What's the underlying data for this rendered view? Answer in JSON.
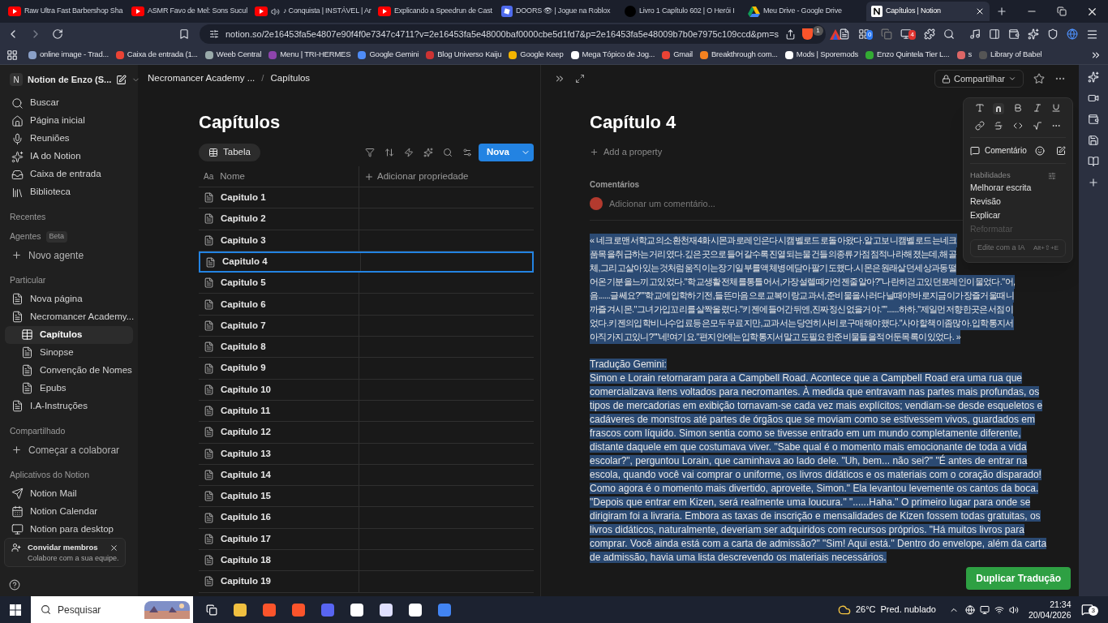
{
  "browser": {
    "tabs": [
      {
        "kind": "youtube",
        "title": "Raw Ultra Fast Barbershop Sha",
        "audio": false,
        "selected": false
      },
      {
        "kind": "youtube",
        "title": "ASMR Favo de Mel: Sons Sucul",
        "audio": false,
        "selected": false
      },
      {
        "kind": "youtube",
        "title": "♪ Conquista | INSTÁVEL | Ar",
        "audio": true,
        "selected": false
      },
      {
        "kind": "youtube",
        "title": "Explicando a Speedrun de Cast",
        "audio": false,
        "selected": false
      },
      {
        "kind": "roblox",
        "title": "DOORS 👁 | Jogue na Roblox",
        "audio": false,
        "selected": false
      },
      {
        "kind": "novel",
        "title": "Livro 1 Capítulo 602 | O Herói I",
        "audio": false,
        "selected": false
      },
      {
        "kind": "drive",
        "title": "Meu Drive - Google Drive",
        "audio": false,
        "selected": false
      },
      {
        "kind": "notion",
        "title": "Capítulos | Notion",
        "audio": false,
        "selected": true
      }
    ],
    "url": "notion.so/2e16453fa5e4807e90f4f0e7347c4711?v=2e16453fa5e48000baf0000cbe5d1fd7&p=2e16453fa5e48009b7b0e7975c109ccd&pm=s",
    "shield_count": "1",
    "extension_badges": [
      "0",
      "4"
    ],
    "bookmarks": [
      "online image - Trad...",
      "Caixa de entrada (1...",
      "Weeb Central",
      "Menu | TRI-HERMES",
      "Google Gemini",
      "Blog Universo Kaiju",
      "Google Keep",
      "Mega Tópico de Jog...",
      "Gmail",
      "Breakthrough com...",
      "Mods | Sporemods",
      "Enzo Quintela Tier L...",
      "s",
      "Library of Babel"
    ]
  },
  "sidebar": {
    "workspace_initial": "N",
    "workspace": "Notion de Enzo (S...",
    "nav": [
      "Buscar",
      "Página inicial",
      "Reuniões",
      "IA do Notion",
      "Caixa de entrada",
      "Biblioteca"
    ],
    "recent_heading": "Recentes",
    "agents_heading": "Agentes",
    "agents_badge": "Beta",
    "new_agent": "Novo agente",
    "private_heading": "Particular",
    "pages": [
      {
        "kind": "page",
        "label": "Nova página",
        "selected": false
      },
      {
        "kind": "page",
        "label": "Necromancer Academy...",
        "selected": false,
        "children": [
          {
            "kind": "database",
            "label": "Capítulos",
            "selected": true
          },
          {
            "kind": "page",
            "label": "Sinopse",
            "selected": false
          },
          {
            "kind": "page",
            "label": "Convenção de Nomes",
            "selected": false
          },
          {
            "kind": "page",
            "label": "Epubs",
            "selected": false
          }
        ]
      },
      {
        "kind": "page",
        "label": "I.A-Instruções",
        "selected": false
      }
    ],
    "shared_heading": "Compartilhado",
    "start_collab": "Começar a colaborar",
    "apps_heading": "Aplicativos do Notion",
    "apps": [
      "Notion Mail",
      "Notion Calendar",
      "Notion para desktop"
    ],
    "invite": {
      "title": "Convidar membros",
      "subtitle": "Colabore com a sua equipe."
    }
  },
  "database": {
    "breadcrumb": [
      "Necromancer Academy ...",
      "Capítulos"
    ],
    "breadcrumb_separator": "/",
    "title": "Capítulos",
    "view": "Tabela",
    "new_button": "Nova",
    "name_column_icon": "Aa",
    "name_column": "Nome",
    "add_property": "Adicionar propriedade",
    "rows": [
      {
        "name": "Capitulo 1",
        "selected": false
      },
      {
        "name": "Capitulo 2",
        "selected": false
      },
      {
        "name": "Capitulo 3",
        "selected": false
      },
      {
        "name": "Capitulo 4",
        "selected": true
      },
      {
        "name": "Capitulo 5",
        "selected": false
      },
      {
        "name": "Capitulo 6",
        "selected": false
      },
      {
        "name": "Capitulo 7",
        "selected": false
      },
      {
        "name": "Capitulo 8",
        "selected": false
      },
      {
        "name": "Capitulo 9",
        "selected": false
      },
      {
        "name": "Capitulo 10",
        "selected": false
      },
      {
        "name": "Capitulo 11",
        "selected": false
      },
      {
        "name": "Capitulo 12",
        "selected": false
      },
      {
        "name": "Capitulo 13",
        "selected": false
      },
      {
        "name": "Capitulo 14",
        "selected": false
      },
      {
        "name": "Capitulo 15",
        "selected": false
      },
      {
        "name": "Capitulo 16",
        "selected": false
      },
      {
        "name": "Capitulo 17",
        "selected": false
      },
      {
        "name": "Capitulo 18",
        "selected": false
      },
      {
        "name": "Capitulo 19",
        "selected": false
      }
    ]
  },
  "peek": {
    "share": "Compartilhar",
    "title": "Capítulo 4",
    "add_property": "Add a property",
    "comments_heading": "Comentários",
    "comment_placeholder": "Adicionar um comentário...",
    "korean_lines": [
      "« 네크로맨서학교의소환천재4화시몬과로레인은다시캠벨로드로돌아왔다.알고보니캠벨로드는네크",
      "품목을취급하는거리였다.깊은곳으로들어갈수록진열되는물건들의종류가점점적나라해졌는데,해골",
      "체,그리고살아있는것처럼움직이는장기일부를액체병에담아팔기도했다.시몬은원래살던세상과동떨",
      "어온기분을느끼고있었다.\"학교생활전체를통틀어서,가장설렐때가언젠줄알아?\"나란히걷고있던로레인이물었다.\"어,",
      "음......글쎄요?\"\"학교에입학하기전,들뜬마음으로교복이랑교과서,준비물을사러다닐때야!바로지금이가장즐거울때니",
      "까즐겨시몬.\"그녀가입꼬리를살짝올렸다.\"키젠에들어간뒤엔,진짜정신없을거야.\"\"......하하.\"제일먼저향한곳은서점이",
      "었다.키젠의입학비나수업료등은모두무료지만,교과서는당연히사비로구매해야했다.\"사야할책이좀많아.입학통지서",
      "아직가지고있니?\"\"네!여기요.\"편지안에는입학통지서말고도필요한준비물들을적어둔목록이있었다. »"
    ],
    "translation_heading": "Tradução Gemini:",
    "translation_lines": [
      "Simon e Lorain retornaram para a Campbell Road. Acontece que a Campbell Road era uma rua que",
      "comercializava itens voltados para necromantes. À medida que entravam nas partes mais profundas, os",
      "tipos de mercadorias em exibição tornavam-se cada vez mais explícitos; vendiam-se desde esqueletos e",
      "cadáveres de monstros até partes de órgãos que se moviam como se estivessem vivos, guardados em",
      "frascos com líquido. Simon sentia como se tivesse entrado em um mundo completamente diferente,",
      "distante daquele em que costumava viver. \"Sabe qual é o momento mais emocionante de toda a vida",
      "escolar?\", perguntou Lorain, que caminhava ao lado dele. \"Uh, bem... não sei?\" \"É antes de entrar na",
      "escola, quando você vai comprar o uniforme, os livros didáticos e os materiais com o coração disparado!",
      "Como agora é o momento mais divertido, aproveite, Simon.\" Ela levantou levemente os cantos da boca.",
      "\"Depois que entrar em Kizen, será realmente uma loucura.\" \"......Haha.\" O primeiro lugar para onde se",
      "dirigiram foi a livraria. Embora as taxas de inscrição e mensalidades de Kizen fossem todas gratuitas, os",
      "livros didáticos, naturalmente, deveriam ser adquiridos com recursos próprios. \"Há muitos livros para",
      "comprar. Você ainda está com a carta de admissão?\" \"Sim! Aqui está.\" Dentro do envelope, além da carta",
      "de admissão, havia uma lista descrevendo os materiais necessários."
    ],
    "duplicate_button": "Duplicar Tradução"
  },
  "menu": {
    "comment": "Comentário",
    "skills_heading": "Habilidades",
    "skills": [
      "Melhorar escrita",
      "Revisão",
      "Explicar",
      "Reformatar"
    ],
    "ai_placeholder": "Edite com a IA",
    "shortcut": "Alt+⇧+E"
  },
  "taskbar": {
    "search": "Pesquisar",
    "temperature": "26°C",
    "weather": "Pred. nublado",
    "time": "21:34",
    "date": "20/04/2026",
    "notifications": "3"
  }
}
